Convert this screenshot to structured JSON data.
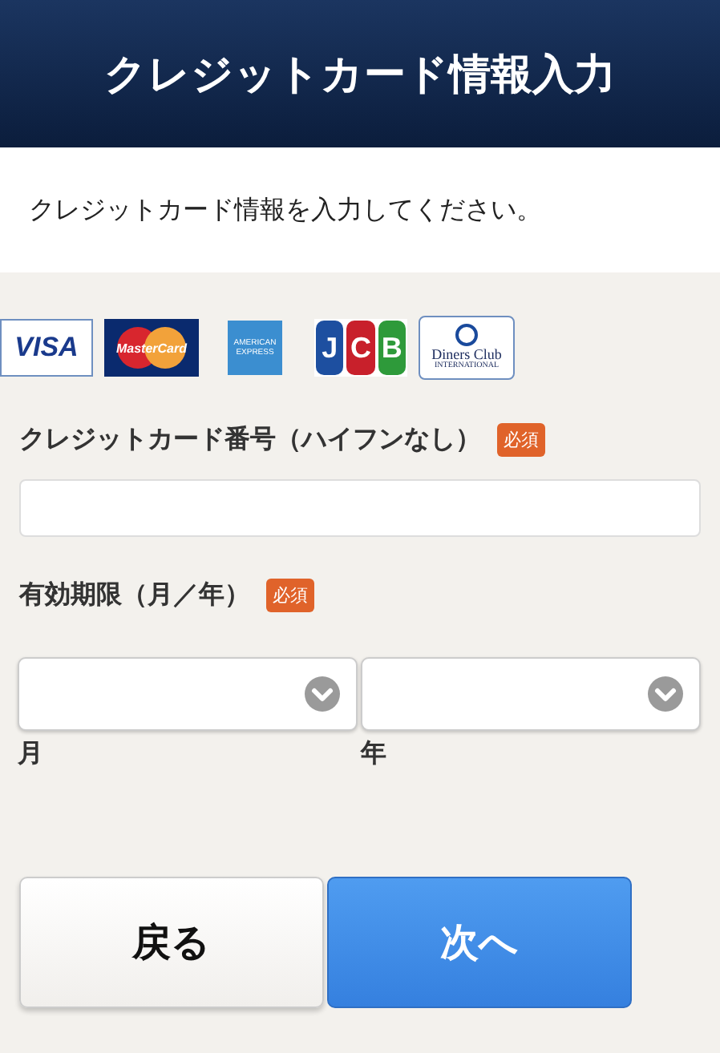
{
  "header": {
    "title": "クレジットカード情報入力"
  },
  "notice": "クレジットカード情報を入力してください。",
  "card_brands": [
    {
      "kind": "visa",
      "lines": [
        "VISA"
      ]
    },
    {
      "kind": "mastercard",
      "lines": [
        "MasterCard"
      ]
    },
    {
      "kind": "amex",
      "lines": [
        "AMERICAN",
        "EXPRESS"
      ]
    },
    {
      "kind": "jcb",
      "lines": [
        "J",
        "C",
        "B"
      ]
    },
    {
      "kind": "diners",
      "lines": [
        "Diners Club",
        "INTERNATIONAL"
      ]
    }
  ],
  "card_number": {
    "label": "クレジットカード番号（ハイフンなし）",
    "badge": "必須"
  },
  "expiry": {
    "label": "有効期限（月／年）",
    "badge": "必須",
    "selects": [
      {
        "caption": "月"
      },
      {
        "caption": "年"
      }
    ]
  },
  "buttons": [
    {
      "kind": "secondary",
      "label": "戻る"
    },
    {
      "kind": "primary",
      "label": "次へ"
    }
  ]
}
